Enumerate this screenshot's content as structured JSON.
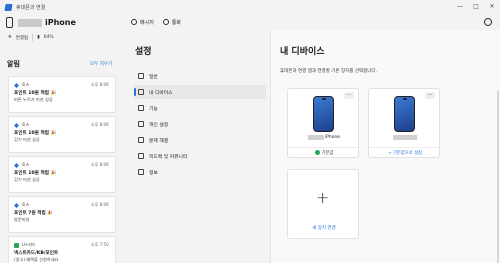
{
  "window": {
    "title": "휴대폰과 연결"
  },
  "left": {
    "phone_name": "iPhone",
    "status_connected": "연결됨",
    "battery": "64%",
    "alerts_title": "알림",
    "clear_all": "모두 지우기",
    "notifications": [
      {
        "app": "토스",
        "time": "오후 8:09",
        "title": "포인트 10원 적립 🎉",
        "body": "버튼 누르기 미션 성공",
        "body2": "",
        "app_color": "#2b6fd6"
      },
      {
        "app": "토스",
        "time": "오후 8:09",
        "title": "포인트 10원 적립 🎉",
        "body": "걷기 미션 성공",
        "body2": "",
        "app_color": "#2b6fd6"
      },
      {
        "app": "토스",
        "time": "오후 8:09",
        "title": "포인트 10원 적립 🎉",
        "body": "걷기 미션 성공",
        "body2": "",
        "app_color": "#2b6fd6"
      },
      {
        "app": "토스",
        "time": "오후 8:09",
        "title": "포인트 7원 적립 🎉",
        "body": "방문미션",
        "body2": "",
        "app_color": "#2b6fd6"
      },
      {
        "app": "U+카드",
        "time": "오후 7:50",
        "title": "넥스트카드/KB/포인트",
        "body": "(광고) 혜택을 신청하세요",
        "body2": "",
        "app_color": "#2aa55b"
      }
    ]
  },
  "topbar": {
    "messages": "메시지",
    "calls": "통화"
  },
  "nav": {
    "title": "설정",
    "items": [
      "일반",
      "내 디바이스",
      "기능",
      "개인 설정",
      "문제 해결",
      "피드백 및 커뮤니티",
      "정보"
    ]
  },
  "main": {
    "title": "내 디바이스",
    "description": "휴대폰과 연결 앱과 연결할 기본 장치를 선택합니다.",
    "device1_name": "iPhone",
    "device1_status": "기본값",
    "device2_link": "기본값으로 설정",
    "add_device": "새 장치 연결",
    "more": "..."
  }
}
